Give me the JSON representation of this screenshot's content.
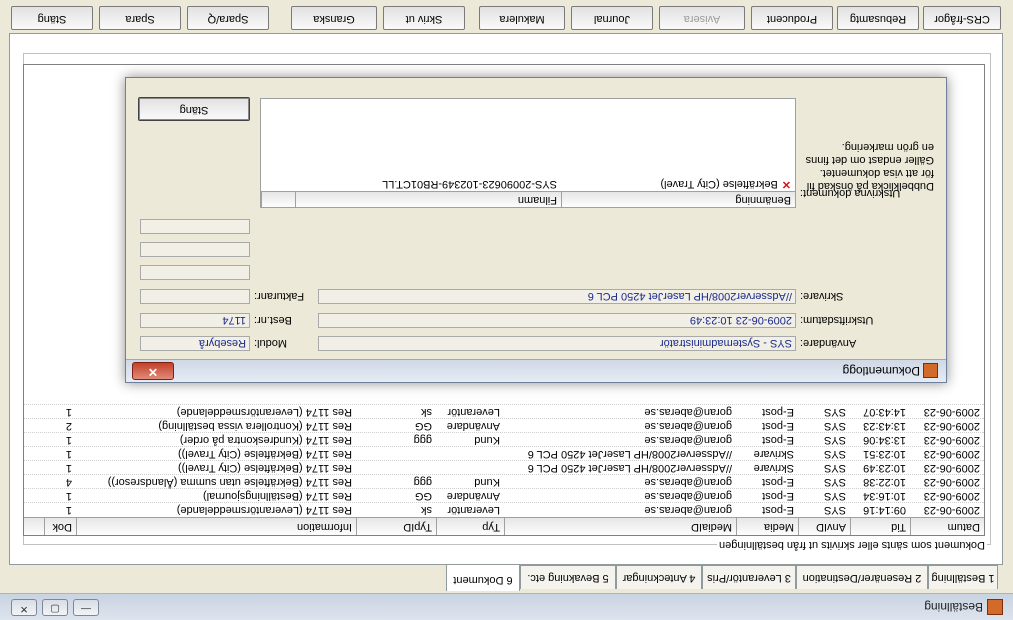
{
  "window": {
    "title": "Beställning",
    "minimize": "—",
    "maximize": "▢",
    "close": "✕"
  },
  "tabs": [
    {
      "label": "1 Beställning"
    },
    {
      "label": "2 Resenärer/Destination"
    },
    {
      "label": "3 Leverantör/Pris"
    },
    {
      "label": "4 Anteckningar"
    },
    {
      "label": "5 Bevakning etc."
    },
    {
      "label": "6 Dokument"
    }
  ],
  "group_label": "Dokument som sänts eller skrivits ut från beställningen",
  "grid": {
    "columns": [
      "Datum",
      "Tid",
      "AnvID",
      "Media",
      "MediaID",
      "Typ",
      "TypID",
      "Information",
      "Dok"
    ],
    "rows": [
      [
        "2009-06-23",
        "09:14:16",
        "SYS",
        "E-post",
        "goran@aberas.se",
        "Leverantör",
        "sk",
        "Res 1174 (Leverantörsmeddelande)",
        "1"
      ],
      [
        "2009-06-23",
        "10:16:34",
        "SYS",
        "E-post",
        "goran@aberas.se",
        "Användare",
        "GG",
        "Res 1174 (Beställningsjournal)",
        "1"
      ],
      [
        "2009-06-23",
        "10:22:38",
        "SYS",
        "E-post",
        "goran@aberas.se",
        "Kund",
        "ggg",
        "Res 1174 (Bekräftelse utan summa (Ålandsresor))",
        "4"
      ],
      [
        "2009-06-23",
        "10:23:49",
        "SYS",
        "Skrivare",
        "//Adsserver2008/HP LaserJet 4250 PCL 6",
        "",
        "",
        "Res 1174 (Bekräftelse (City Travel))",
        "1"
      ],
      [
        "2009-06-23",
        "10:23:51",
        "SYS",
        "Skrivare",
        "//Adsserver2008/HP LaserJet 4250 PCL 6",
        "",
        "",
        "Res 1174 (Bekräftelse (City Travel))",
        "1"
      ],
      [
        "2009-06-23",
        "13:34:06",
        "SYS",
        "E-post",
        "goran@aberas.se",
        "Kund",
        "ggg",
        "Res 1174 (Kundreskontra på order)",
        "1"
      ],
      [
        "2009-06-23",
        "13:43:23",
        "SYS",
        "E-post",
        "goran@aberas.se",
        "Användare",
        "GG",
        "Res 1174 (Kontrollera vissa beställning)",
        "2"
      ],
      [
        "2009-06-23",
        "14:43:07",
        "SYS",
        "E-post",
        "goran@aberas.se",
        "Leverantör",
        "sk",
        "Res 1174 (Leverantörsmeddelande)",
        "1"
      ]
    ]
  },
  "buttons": [
    {
      "label": "Stäng",
      "enabled": true
    },
    {
      "label": "Spara",
      "enabled": true
    },
    {
      "label": "Spara/Q",
      "enabled": true
    },
    {
      "label": "Granska",
      "enabled": true
    },
    {
      "label": "Skriv ut",
      "enabled": true
    },
    {
      "label": "Makulera",
      "enabled": true
    },
    {
      "label": "Journal",
      "enabled": true
    },
    {
      "label": "Avisera",
      "enabled": false
    },
    {
      "label": "Producent",
      "enabled": true
    },
    {
      "label": "Rebusamtg",
      "enabled": true
    },
    {
      "label": "CRS-frågor",
      "enabled": true
    }
  ],
  "dialog": {
    "title": "Dokumentlogg",
    "close": "✕",
    "labels": {
      "user": "Användare:",
      "printed_at": "Utskriftsdatum:",
      "printer": "Skrivare:",
      "module": "Modul:",
      "order_no": "Best.nr:",
      "invoice_no": "Fakturanr:",
      "docs": "Utskrivna dokument:"
    },
    "values": {
      "user": "SYS - Systemadministratör",
      "printed_at": "2009-06-23  10:23:49",
      "printer": "//Adsserver2008/HP LaserJet 4250 PCL 6",
      "module": "Resebyrå",
      "order_no": "1174",
      "invoice_no": ""
    },
    "doc_columns": [
      "Benämning",
      "Filnamn"
    ],
    "doc_rows": [
      {
        "name": "Bekräftelse (City Travel)",
        "file": "SYS-20090623-102349-RB01CT.LL"
      }
    ],
    "hint": "Dubbelklicka på önskad fil för att visa dokumentet. Gäller endast om det finns en grön markering.",
    "close_button": "Stäng"
  }
}
